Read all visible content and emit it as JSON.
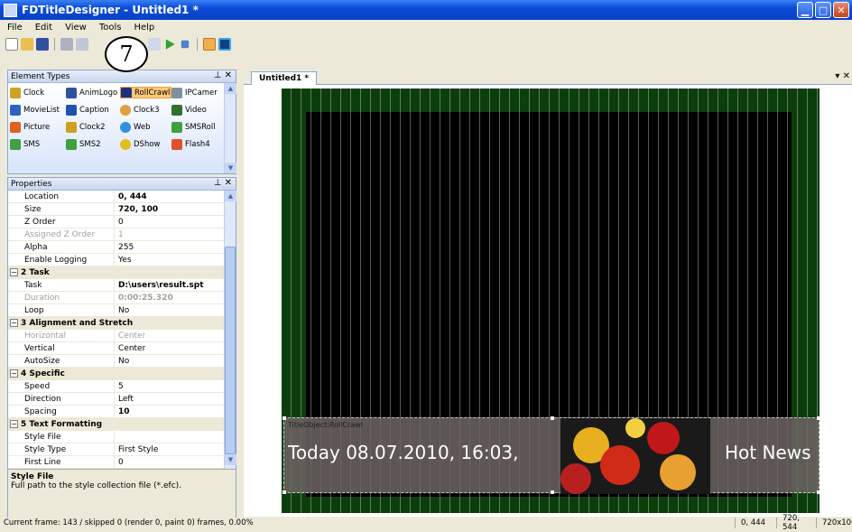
{
  "window": {
    "title": "FDTitleDesigner - Untitled1 *"
  },
  "menu": [
    "File",
    "Edit",
    "View",
    "Tools",
    "Help"
  ],
  "callout": "7",
  "element_types": {
    "title": "Element Types",
    "pin": "⊥ ✕",
    "items": [
      "Clock",
      "AnimLogo",
      "RollCrawl",
      "IPCamer",
      "MovieList",
      "Caption",
      "Clock3",
      "Video",
      "Picture",
      "Clock2",
      "Web",
      "SMSRoll",
      "SMS",
      "SMS2",
      "DShow",
      "Flash4"
    ]
  },
  "properties": {
    "title": "Properties",
    "pin": "⊥ ✕",
    "rows": [
      {
        "k": "Location",
        "v": "0, 444",
        "style": "bold"
      },
      {
        "k": "Size",
        "v": "720, 100",
        "style": "bold"
      },
      {
        "k": "Z Order",
        "v": "0",
        "style": ""
      },
      {
        "k": "Assigned Z Order",
        "v": "1",
        "style": "dis"
      },
      {
        "k": "Alpha",
        "v": "255",
        "style": ""
      },
      {
        "k": "Enable Logging",
        "v": "Yes",
        "style": ""
      },
      {
        "k": "2 Task",
        "v": "",
        "style": "cat"
      },
      {
        "k": "Task",
        "v": "D:\\users\\result.spt",
        "style": "bold"
      },
      {
        "k": "Duration",
        "v": "0:00:25.320",
        "style": "dis bold"
      },
      {
        "k": "Loop",
        "v": "No",
        "style": ""
      },
      {
        "k": "3 Alignment and Stretch",
        "v": "",
        "style": "cat"
      },
      {
        "k": "Horizontal",
        "v": "Center",
        "style": "dis"
      },
      {
        "k": "Vertical",
        "v": "Center",
        "style": ""
      },
      {
        "k": "AutoSize",
        "v": "No",
        "style": ""
      },
      {
        "k": "4 Specific",
        "v": "",
        "style": "cat"
      },
      {
        "k": "Speed",
        "v": "5",
        "style": ""
      },
      {
        "k": "Direction",
        "v": "Left",
        "style": ""
      },
      {
        "k": "Spacing",
        "v": "10",
        "style": "bold"
      },
      {
        "k": "5 Text Formatting",
        "v": "",
        "style": "cat"
      },
      {
        "k": "Style File",
        "v": "",
        "style": ""
      },
      {
        "k": "Style Type",
        "v": "First Style",
        "style": ""
      },
      {
        "k": "First Line",
        "v": "0",
        "style": ""
      }
    ],
    "desc_title": "Style File",
    "desc_text": "Full path to the style collection file (*.efc)."
  },
  "document": {
    "tab": "Untitled1 *",
    "tab_controls": "▾ ✕",
    "object_label": "TitleObject:RollCrawl",
    "roll_text_1": "Today 08.07.2010, 16:03,",
    "roll_text_2": "Hot News"
  },
  "status": {
    "text": "Current frame: 143 / skipped 0 (render 0, paint 0) frames, 0.00%",
    "loc": "0, 444",
    "res": "720, 544",
    "size": "720x100"
  },
  "colors": {
    "title_blue": "#0a4bd8",
    "canvas_green": "#0c3e0c",
    "selected": "#ffc878"
  }
}
